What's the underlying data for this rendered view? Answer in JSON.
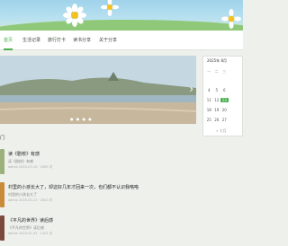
{
  "nav": {
    "items": [
      {
        "label": "首页",
        "active": true
      },
      {
        "label": "生活记录",
        "active": false
      },
      {
        "label": "旅行打卡",
        "active": false
      },
      {
        "label": "读书分享",
        "active": false
      },
      {
        "label": "关于分享",
        "active": false
      }
    ]
  },
  "calendar": {
    "title": "2025年 8月",
    "weekdays": [
      "一",
      "二",
      "三"
    ],
    "rows": [
      [
        "",
        "",
        ""
      ],
      [
        "4",
        "5",
        "6"
      ],
      [
        "11",
        "12",
        "13"
      ],
      [
        "18",
        "19",
        "20"
      ],
      [
        "25",
        "26",
        "27"
      ]
    ],
    "today": "13",
    "link": "« 七月"
  },
  "section": {
    "title": "门"
  },
  "posts": [
    {
      "title": "读《剧校》有感",
      "excerpt": "读《剧校》有感",
      "meta": "admin  2025-03-10 · 2065 次",
      "thumb_color": "#9bb07a"
    },
    {
      "title": "村里的小孩长大了，却这好几年才回来一次，也们都不认识我咯咯",
      "excerpt": "村里的小孩长大了",
      "meta": "admin  2025-02-21 · 2043 次",
      "thumb_color": "#c98a3a"
    },
    {
      "title": "《平凡的世界》读后感",
      "excerpt": "《平凡的世界》读后感",
      "meta": "admin  2025-01-05 · 2101 次",
      "thumb_color": "#7a4b3a"
    }
  ],
  "colors": {
    "accent": "#4caf50"
  }
}
